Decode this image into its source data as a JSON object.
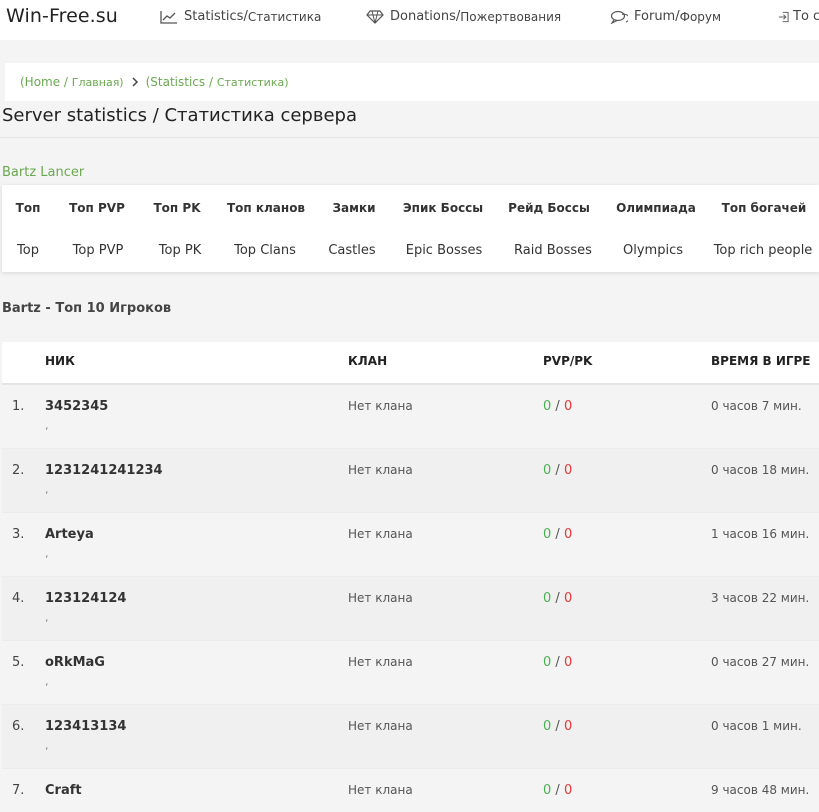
{
  "site": {
    "logo": "Win-Free.su"
  },
  "nav": [
    {
      "en": "Statistics",
      "sep": " / ",
      "ru": "Статистика",
      "icon": "chart-line-icon"
    },
    {
      "en": "Donations",
      "sep": " / ",
      "ru": "Пожертвования",
      "icon": "diamond-icon"
    },
    {
      "en": "Forum",
      "sep": " / ",
      "ru": "Форум",
      "icon": "chat-icon"
    },
    {
      "en": "То с",
      "icon": "login-icon"
    }
  ],
  "breadcrumb": {
    "home": "(Home / ",
    "home_ru": "Главная)",
    "current": "(Statistics / ",
    "current_ru": "Статистика)"
  },
  "page": {
    "title": "Server statistics / Статистика сервера",
    "server": "Bartz Lancer",
    "section": "Bartz - Топ 10 Игроков"
  },
  "tabs": [
    {
      "ru": "Топ",
      "en": "Top"
    },
    {
      "ru": "Топ PVP",
      "en": "Top PVP"
    },
    {
      "ru": "Топ PK",
      "en": "Top PK"
    },
    {
      "ru": "Топ кланов",
      "en": "Top Clans"
    },
    {
      "ru": "Замки",
      "en": "Castles"
    },
    {
      "ru": "Эпик Боссы",
      "en": "Epic Bosses"
    },
    {
      "ru": "Рейд Боссы",
      "en": "Raid Bosses"
    },
    {
      "ru": "Олимпиада",
      "en": "Olympics"
    },
    {
      "ru": "Топ богачей",
      "en": "Top rich people"
    }
  ],
  "table": {
    "headers": {
      "nick": "НИК",
      "clan": "КЛАН",
      "pvppk": "PVP/PK",
      "time": "ВРЕМЯ В ИГРЕ"
    },
    "rows": [
      {
        "num": "1.",
        "nick": "3452345",
        "sub": ",",
        "clan": "Нет клана",
        "pvp": "0",
        "slash": " / ",
        "pk": "0",
        "time": "0 часов 7 мин."
      },
      {
        "num": "2.",
        "nick": "1231241241234",
        "sub": ",",
        "clan": "Нет клана",
        "pvp": "0",
        "slash": " / ",
        "pk": "0",
        "time": "0 часов 18 мин."
      },
      {
        "num": "3.",
        "nick": "Arteya",
        "sub": ",",
        "clan": "Нет клана",
        "pvp": "0",
        "slash": " / ",
        "pk": "0",
        "time": "1 часов 16 мин."
      },
      {
        "num": "4.",
        "nick": "123124124",
        "sub": ",",
        "clan": "Нет клана",
        "pvp": "0",
        "slash": " / ",
        "pk": "0",
        "time": "3 часов 22 мин."
      },
      {
        "num": "5.",
        "nick": "oRkMaG",
        "sub": ",",
        "clan": "Нет клана",
        "pvp": "0",
        "slash": " / ",
        "pk": "0",
        "time": "0 часов 27 мин."
      },
      {
        "num": "6.",
        "nick": "123413134",
        "sub": ",",
        "clan": "Нет клана",
        "pvp": "0",
        "slash": " / ",
        "pk": "0",
        "time": "0 часов 1 мин."
      },
      {
        "num": "7.",
        "nick": "Craft",
        "sub": "",
        "clan": "Нет клана",
        "pvp": "0",
        "slash": " / ",
        "pk": "0",
        "time": "9 часов 48 мин."
      }
    ]
  },
  "colors": {
    "accent": "#6aa84f",
    "pvp": "#4caf50",
    "pk": "#e53935"
  }
}
